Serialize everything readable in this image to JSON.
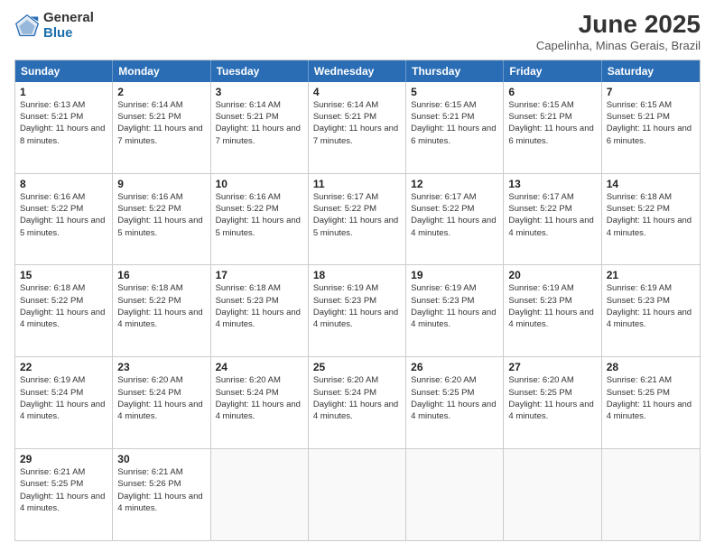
{
  "header": {
    "logo_general": "General",
    "logo_blue": "Blue",
    "month_title": "June 2025",
    "location": "Capelinha, Minas Gerais, Brazil"
  },
  "days_of_week": [
    "Sunday",
    "Monday",
    "Tuesday",
    "Wednesday",
    "Thursday",
    "Friday",
    "Saturday"
  ],
  "weeks": [
    [
      {
        "day": "1",
        "sunrise": "6:13 AM",
        "sunset": "5:21 PM",
        "daylight": "11 hours and 8 minutes."
      },
      {
        "day": "2",
        "sunrise": "6:14 AM",
        "sunset": "5:21 PM",
        "daylight": "11 hours and 7 minutes."
      },
      {
        "day": "3",
        "sunrise": "6:14 AM",
        "sunset": "5:21 PM",
        "daylight": "11 hours and 7 minutes."
      },
      {
        "day": "4",
        "sunrise": "6:14 AM",
        "sunset": "5:21 PM",
        "daylight": "11 hours and 7 minutes."
      },
      {
        "day": "5",
        "sunrise": "6:15 AM",
        "sunset": "5:21 PM",
        "daylight": "11 hours and 6 minutes."
      },
      {
        "day": "6",
        "sunrise": "6:15 AM",
        "sunset": "5:21 PM",
        "daylight": "11 hours and 6 minutes."
      },
      {
        "day": "7",
        "sunrise": "6:15 AM",
        "sunset": "5:21 PM",
        "daylight": "11 hours and 6 minutes."
      }
    ],
    [
      {
        "day": "8",
        "sunrise": "6:16 AM",
        "sunset": "5:22 PM",
        "daylight": "11 hours and 5 minutes."
      },
      {
        "day": "9",
        "sunrise": "6:16 AM",
        "sunset": "5:22 PM",
        "daylight": "11 hours and 5 minutes."
      },
      {
        "day": "10",
        "sunrise": "6:16 AM",
        "sunset": "5:22 PM",
        "daylight": "11 hours and 5 minutes."
      },
      {
        "day": "11",
        "sunrise": "6:17 AM",
        "sunset": "5:22 PM",
        "daylight": "11 hours and 5 minutes."
      },
      {
        "day": "12",
        "sunrise": "6:17 AM",
        "sunset": "5:22 PM",
        "daylight": "11 hours and 4 minutes."
      },
      {
        "day": "13",
        "sunrise": "6:17 AM",
        "sunset": "5:22 PM",
        "daylight": "11 hours and 4 minutes."
      },
      {
        "day": "14",
        "sunrise": "6:18 AM",
        "sunset": "5:22 PM",
        "daylight": "11 hours and 4 minutes."
      }
    ],
    [
      {
        "day": "15",
        "sunrise": "6:18 AM",
        "sunset": "5:22 PM",
        "daylight": "11 hours and 4 minutes."
      },
      {
        "day": "16",
        "sunrise": "6:18 AM",
        "sunset": "5:22 PM",
        "daylight": "11 hours and 4 minutes."
      },
      {
        "day": "17",
        "sunrise": "6:18 AM",
        "sunset": "5:23 PM",
        "daylight": "11 hours and 4 minutes."
      },
      {
        "day": "18",
        "sunrise": "6:19 AM",
        "sunset": "5:23 PM",
        "daylight": "11 hours and 4 minutes."
      },
      {
        "day": "19",
        "sunrise": "6:19 AM",
        "sunset": "5:23 PM",
        "daylight": "11 hours and 4 minutes."
      },
      {
        "day": "20",
        "sunrise": "6:19 AM",
        "sunset": "5:23 PM",
        "daylight": "11 hours and 4 minutes."
      },
      {
        "day": "21",
        "sunrise": "6:19 AM",
        "sunset": "5:23 PM",
        "daylight": "11 hours and 4 minutes."
      }
    ],
    [
      {
        "day": "22",
        "sunrise": "6:19 AM",
        "sunset": "5:24 PM",
        "daylight": "11 hours and 4 minutes."
      },
      {
        "day": "23",
        "sunrise": "6:20 AM",
        "sunset": "5:24 PM",
        "daylight": "11 hours and 4 minutes."
      },
      {
        "day": "24",
        "sunrise": "6:20 AM",
        "sunset": "5:24 PM",
        "daylight": "11 hours and 4 minutes."
      },
      {
        "day": "25",
        "sunrise": "6:20 AM",
        "sunset": "5:24 PM",
        "daylight": "11 hours and 4 minutes."
      },
      {
        "day": "26",
        "sunrise": "6:20 AM",
        "sunset": "5:25 PM",
        "daylight": "11 hours and 4 minutes."
      },
      {
        "day": "27",
        "sunrise": "6:20 AM",
        "sunset": "5:25 PM",
        "daylight": "11 hours and 4 minutes."
      },
      {
        "day": "28",
        "sunrise": "6:21 AM",
        "sunset": "5:25 PM",
        "daylight": "11 hours and 4 minutes."
      }
    ],
    [
      {
        "day": "29",
        "sunrise": "6:21 AM",
        "sunset": "5:25 PM",
        "daylight": "11 hours and 4 minutes."
      },
      {
        "day": "30",
        "sunrise": "6:21 AM",
        "sunset": "5:26 PM",
        "daylight": "11 hours and 4 minutes."
      },
      null,
      null,
      null,
      null,
      null
    ]
  ],
  "labels": {
    "sunrise": "Sunrise:",
    "sunset": "Sunset:",
    "daylight": "Daylight:"
  }
}
